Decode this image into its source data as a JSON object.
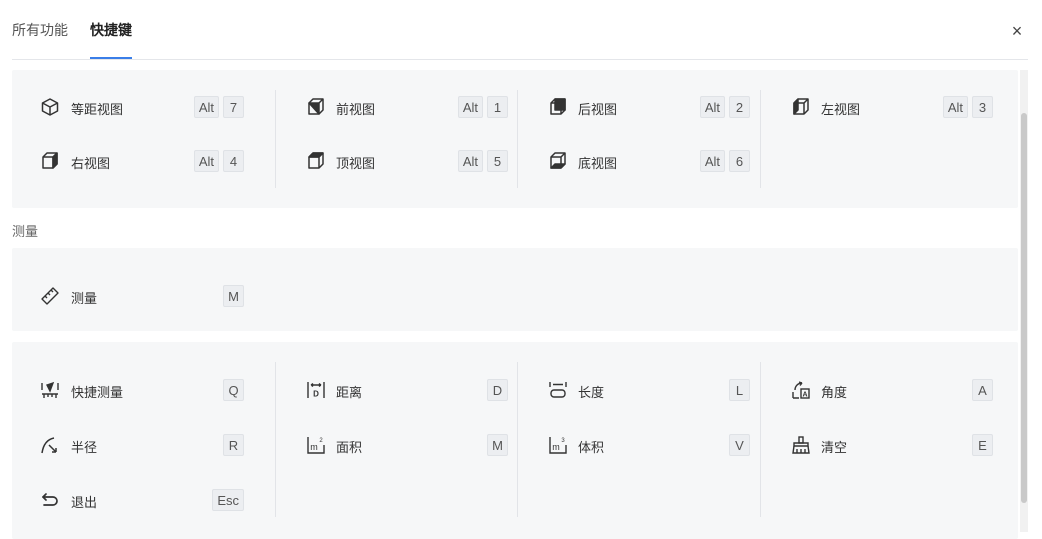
{
  "tabs": [
    {
      "label": "所有功能",
      "active": false
    },
    {
      "label": "快捷键",
      "active": true
    }
  ],
  "close_label": "×",
  "colors": {
    "accent": "#3a7ee8",
    "section_bg": "#f6f7f8",
    "key_bg": "#eceef1"
  },
  "view_section": {
    "items": [
      {
        "label": "等距视图",
        "icon": "isometric-cube-icon",
        "keys": [
          "Alt",
          "7"
        ]
      },
      {
        "label": "前视图",
        "icon": "front-view-cube-icon",
        "keys": [
          "Alt",
          "1"
        ]
      },
      {
        "label": "后视图",
        "icon": "back-view-cube-icon",
        "keys": [
          "Alt",
          "2"
        ]
      },
      {
        "label": "左视图",
        "icon": "left-view-cube-icon",
        "keys": [
          "Alt",
          "3"
        ]
      },
      {
        "label": "右视图",
        "icon": "right-view-cube-icon",
        "keys": [
          "Alt",
          "4"
        ]
      },
      {
        "label": "顶视图",
        "icon": "top-view-cube-icon",
        "keys": [
          "Alt",
          "5"
        ]
      },
      {
        "label": "底视图",
        "icon": "bottom-view-cube-icon",
        "keys": [
          "Alt",
          "6"
        ]
      }
    ]
  },
  "measure_section": {
    "title": "测量",
    "items": [
      {
        "label": "测量",
        "icon": "ruler-icon",
        "keys": [
          "M"
        ]
      }
    ]
  },
  "tools_section": {
    "items": [
      {
        "label": "快捷测量",
        "icon": "quick-measure-icon",
        "keys": [
          "Q"
        ]
      },
      {
        "label": "距离",
        "icon": "distance-icon",
        "keys": [
          "D"
        ]
      },
      {
        "label": "长度",
        "icon": "length-icon",
        "keys": [
          "L"
        ]
      },
      {
        "label": "角度",
        "icon": "angle-icon",
        "keys": [
          "A"
        ]
      },
      {
        "label": "半径",
        "icon": "radius-icon",
        "keys": [
          "R"
        ]
      },
      {
        "label": "面积",
        "icon": "area-icon",
        "keys": [
          "M"
        ]
      },
      {
        "label": "体积",
        "icon": "volume-icon",
        "keys": [
          "V"
        ]
      },
      {
        "label": "清空",
        "icon": "clear-brush-icon",
        "keys": [
          "E"
        ]
      },
      {
        "label": "退出",
        "icon": "exit-arrow-icon",
        "keys": [
          "Esc"
        ]
      }
    ]
  }
}
